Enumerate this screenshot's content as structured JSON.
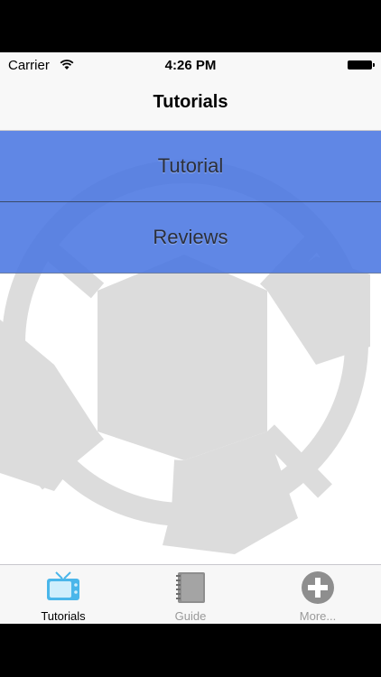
{
  "status_bar": {
    "carrier": "Carrier",
    "time": "4:26 PM"
  },
  "nav": {
    "title": "Tutorials"
  },
  "menu": {
    "items": [
      {
        "label": "Tutorial"
      },
      {
        "label": "Reviews"
      }
    ]
  },
  "tab_bar": {
    "items": [
      {
        "label": "Tutorials",
        "icon": "tv-icon",
        "active": true
      },
      {
        "label": "Guide",
        "icon": "notebook-icon",
        "active": false
      },
      {
        "label": "More...",
        "icon": "plus-circle-icon",
        "active": false
      }
    ]
  },
  "colors": {
    "menu_bg": "#5b85e6",
    "active_icon": "#4ab6ea",
    "inactive_icon": "#8e8e8e"
  }
}
